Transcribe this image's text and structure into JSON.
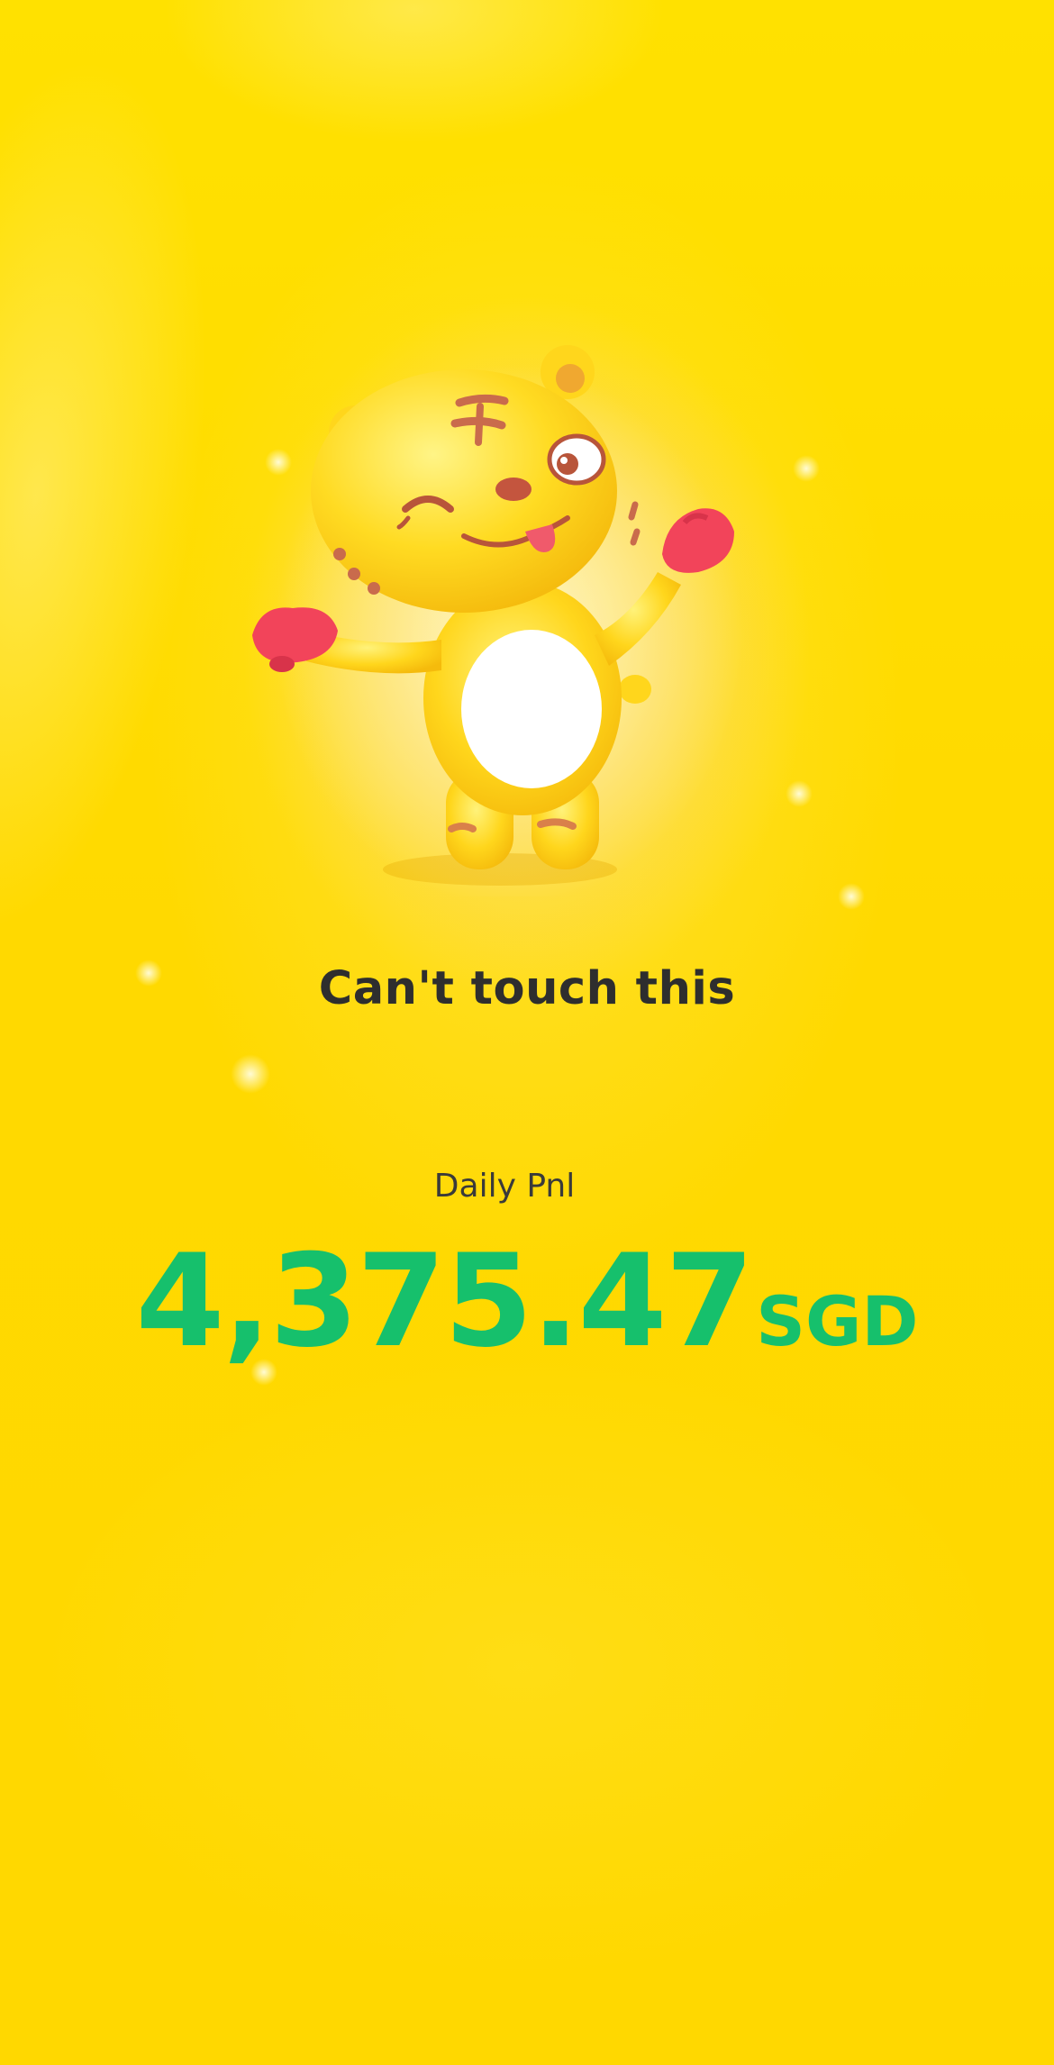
{
  "hero": {
    "headline": "Can't touch this"
  },
  "pnl": {
    "label": "Daily Pnl",
    "amount": "4,375.47",
    "currency": "SGD"
  },
  "colors": {
    "background": "#ffdb00",
    "headline_text": "#2e2e2e",
    "positive_value": "#16c06c",
    "mascot_body": "#ffd21f",
    "mascot_gloves": "#f2445a"
  },
  "icons": {
    "mascot": "winking-tiger-mascot-icon"
  }
}
